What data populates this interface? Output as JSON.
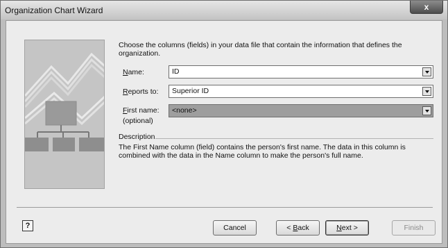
{
  "window": {
    "title": "Organization Chart Wizard",
    "close_glyph": "x"
  },
  "instructions": "Choose the columns (fields) in your data file that contain the information that defines the organization.",
  "fields": [
    {
      "label_accel": "N",
      "label_rest": "ame:",
      "value": "ID"
    },
    {
      "label_accel": "R",
      "label_rest": "eports to:",
      "value": "Superior ID"
    },
    {
      "label_accel": "F",
      "label_rest": "irst name:",
      "sublabel": "(optional)",
      "value": "<none>"
    }
  ],
  "description": {
    "heading": "Description",
    "text": "The First Name column (field) contains the person's first name. The data in this column is combined with the data in the Name column to make the person's full name."
  },
  "buttons": {
    "help": "?",
    "cancel": "Cancel",
    "back_prefix": "< ",
    "back_accel": "B",
    "back_rest": "ack",
    "next_accel": "N",
    "next_rest": "ext >",
    "finish": "Finish"
  },
  "icons": {
    "art": "org-chart-illustration",
    "help": "help-icon",
    "dropdown": "chevron-down-icon"
  }
}
